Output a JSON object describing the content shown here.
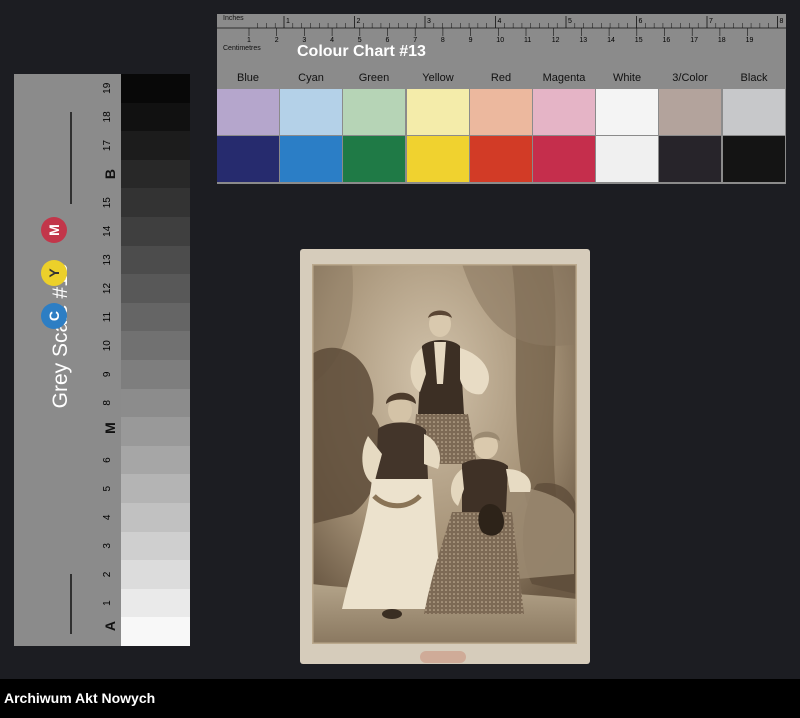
{
  "colour_chart": {
    "title": "Colour Chart #13",
    "inches_label": "Inches",
    "centimetres_label": "Centimetres",
    "inch_ticks": [
      "1",
      "2",
      "3",
      "4",
      "5",
      "6",
      "7",
      "8"
    ],
    "cm_ticks": [
      "1",
      "2",
      "3",
      "4",
      "5",
      "6",
      "7",
      "8",
      "9",
      "10",
      "11",
      "12",
      "13",
      "14",
      "15",
      "16",
      "17",
      "18",
      "19"
    ],
    "swatches": [
      {
        "label": "Blue",
        "top": "#b5a6cc",
        "bottom": "#262b6e"
      },
      {
        "label": "Cyan",
        "top": "#b4d1e8",
        "bottom": "#2b7ec6"
      },
      {
        "label": "Green",
        "top": "#b6d4b6",
        "bottom": "#1f7a46"
      },
      {
        "label": "Yellow",
        "top": "#f4ecaa",
        "bottom": "#f0d22f"
      },
      {
        "label": "Red",
        "top": "#ecb89e",
        "bottom": "#d23b26"
      },
      {
        "label": "Magenta",
        "top": "#e5b4c6",
        "bottom": "#c52e4c"
      },
      {
        "label": "White",
        "top": "#f4f4f4",
        "bottom": "#f0f0f0"
      },
      {
        "label": "3/Color",
        "top": "#b3a39c",
        "bottom": "#27242a"
      },
      {
        "label": "Black",
        "top": "#c7c8ca",
        "bottom": "#141414"
      }
    ]
  },
  "grey_scale": {
    "title": "Grey Scale #13",
    "steps": [
      "19",
      "18",
      "17",
      "B",
      "15",
      "14",
      "13",
      "12",
      "11",
      "10",
      "9",
      "8",
      "M",
      "6",
      "5",
      "4",
      "3",
      "2",
      "1",
      "A"
    ],
    "marks": {
      "top": "B",
      "middle": "M",
      "bottom": "A"
    },
    "cym": [
      {
        "letter": "M",
        "color": "#c2364a",
        "text_color": "#ffffff"
      },
      {
        "letter": "Y",
        "color": "#ecd02a",
        "text_color": "#333333"
      },
      {
        "letter": "C",
        "color": "#2d7ec4",
        "text_color": "#ffffff"
      }
    ]
  },
  "footer": {
    "text": "Archiwum Akt Nowych"
  }
}
